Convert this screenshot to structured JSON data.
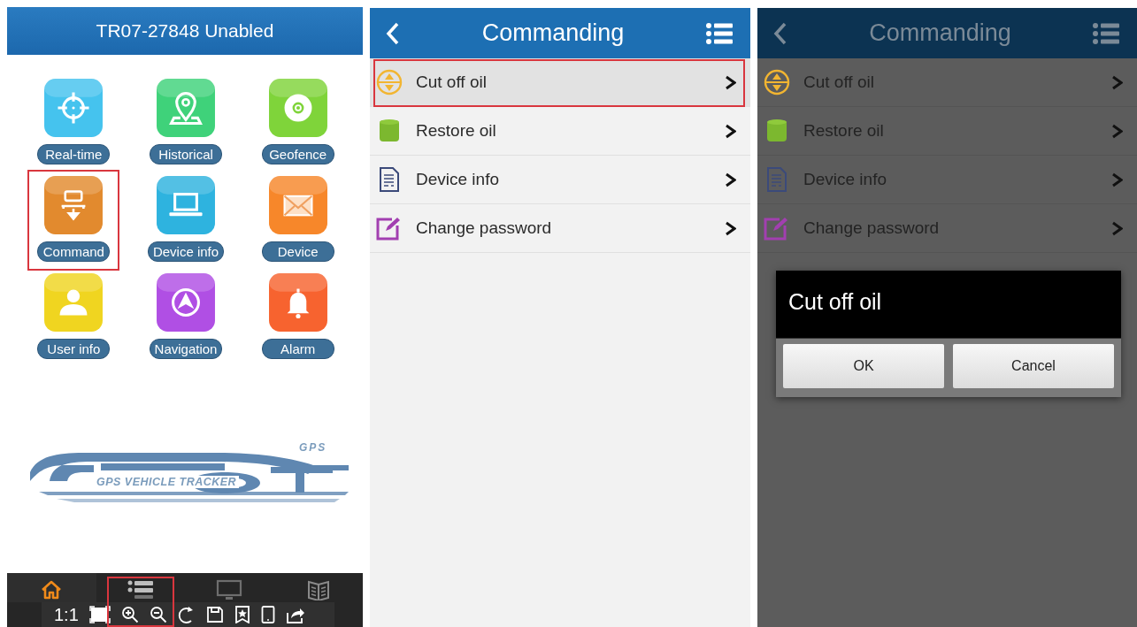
{
  "screens": [
    {
      "kind": "home",
      "title": "TR07-27848 Unabled",
      "tiles": [
        {
          "label": "Real-time",
          "color": "#45c3ee",
          "highlighted": false
        },
        {
          "label": "Historical",
          "color": "#3fd27a",
          "highlighted": false
        },
        {
          "label": "Geofence",
          "color": "#7fd43a",
          "highlighted": false
        },
        {
          "label": "Command",
          "color": "#e28a2e",
          "highlighted": true
        },
        {
          "label": "Device info",
          "color": "#2eb3df",
          "highlighted": false
        },
        {
          "label": "Device",
          "color": "#f7872a",
          "highlighted": false
        },
        {
          "label": "User info",
          "color": "#f0d520",
          "highlighted": false
        },
        {
          "label": "Navigation",
          "color": "#b04fe4",
          "highlighted": false
        },
        {
          "label": "Alarm",
          "color": "#f7632f",
          "highlighted": false
        }
      ],
      "logo": {
        "badge": "GPS",
        "caption": "GPS VEHICLE TRACKER"
      },
      "nav_tabs": [
        {
          "selected": true,
          "highlighted": false
        },
        {
          "selected": false,
          "highlighted": true
        },
        {
          "selected": false,
          "highlighted": false
        },
        {
          "selected": false,
          "highlighted": false
        }
      ],
      "viewer_toolbar": {
        "zoom_label": "1:1"
      }
    },
    {
      "kind": "menu",
      "title": "Commanding",
      "dimmed": false,
      "items": [
        {
          "label": "Cut off oil",
          "selected": true,
          "highlighted": true
        },
        {
          "label": "Restore oil",
          "selected": false,
          "highlighted": false
        },
        {
          "label": "Device info",
          "selected": false,
          "highlighted": false
        },
        {
          "label": "Change password",
          "selected": false,
          "highlighted": false
        }
      ]
    },
    {
      "kind": "menu",
      "title": "Commanding",
      "dimmed": true,
      "items": [
        {
          "label": "Cut off oil",
          "selected": false,
          "highlighted": false
        },
        {
          "label": "Restore oil",
          "selected": false,
          "highlighted": false
        },
        {
          "label": "Device info",
          "selected": false,
          "highlighted": false
        },
        {
          "label": "Change password",
          "selected": false,
          "highlighted": false
        }
      ],
      "dialog": {
        "title": "Cut off oil",
        "buttons": [
          "OK",
          "Cancel"
        ]
      }
    }
  ]
}
